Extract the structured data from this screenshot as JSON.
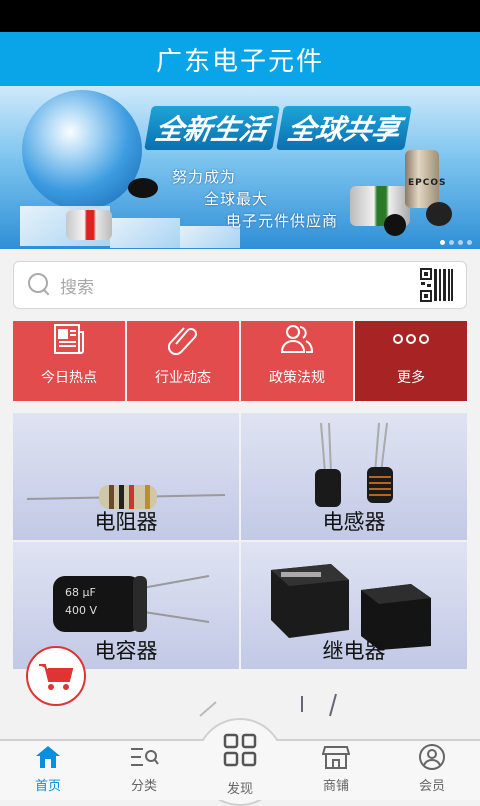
{
  "app": {
    "title": "广东电子元件"
  },
  "banner": {
    "slogan_1": "全新生活",
    "slogan_2": "全球共享",
    "line_1": "努力成为",
    "line_2": "全球最大",
    "line_3": "电子元件供应商",
    "brand_label": "EPCOS",
    "slides": 4,
    "active_slide": 1
  },
  "search": {
    "placeholder": "搜索",
    "scan_icon": "qr-code-icon"
  },
  "categories": [
    {
      "label": "今日热点",
      "icon": "newspaper-icon",
      "color": "#e24c4c"
    },
    {
      "label": "行业动态",
      "icon": "paperclip-icon",
      "color": "#e24c4c"
    },
    {
      "label": "政策法规",
      "icon": "people-icon",
      "color": "#e24c4c"
    },
    {
      "label": "更多",
      "icon": "more-dots-icon",
      "color": "#a82424"
    }
  ],
  "products": [
    {
      "name": "电阻器",
      "image": "resistor"
    },
    {
      "name": "电感器",
      "image": "inductor"
    },
    {
      "name": "电容器",
      "image": "capacitor",
      "print_1": "68 μF",
      "print_2": "400 V"
    },
    {
      "name": "继电器",
      "image": "relay"
    }
  ],
  "cart": {
    "icon": "cart-icon",
    "color": "#e03333"
  },
  "tabs": [
    {
      "label": "首页",
      "icon": "home-icon",
      "active": true
    },
    {
      "label": "分类",
      "icon": "category-search-icon",
      "active": false
    },
    {
      "label": "发现",
      "icon": "grid-icon",
      "active": false
    },
    {
      "label": "商铺",
      "icon": "shop-icon",
      "active": false
    },
    {
      "label": "会员",
      "icon": "user-icon",
      "active": false
    }
  ],
  "colors": {
    "header": "#0aa5e9",
    "accent": "#0a8ee0",
    "category": "#e24c4c",
    "category_more": "#a82424"
  }
}
